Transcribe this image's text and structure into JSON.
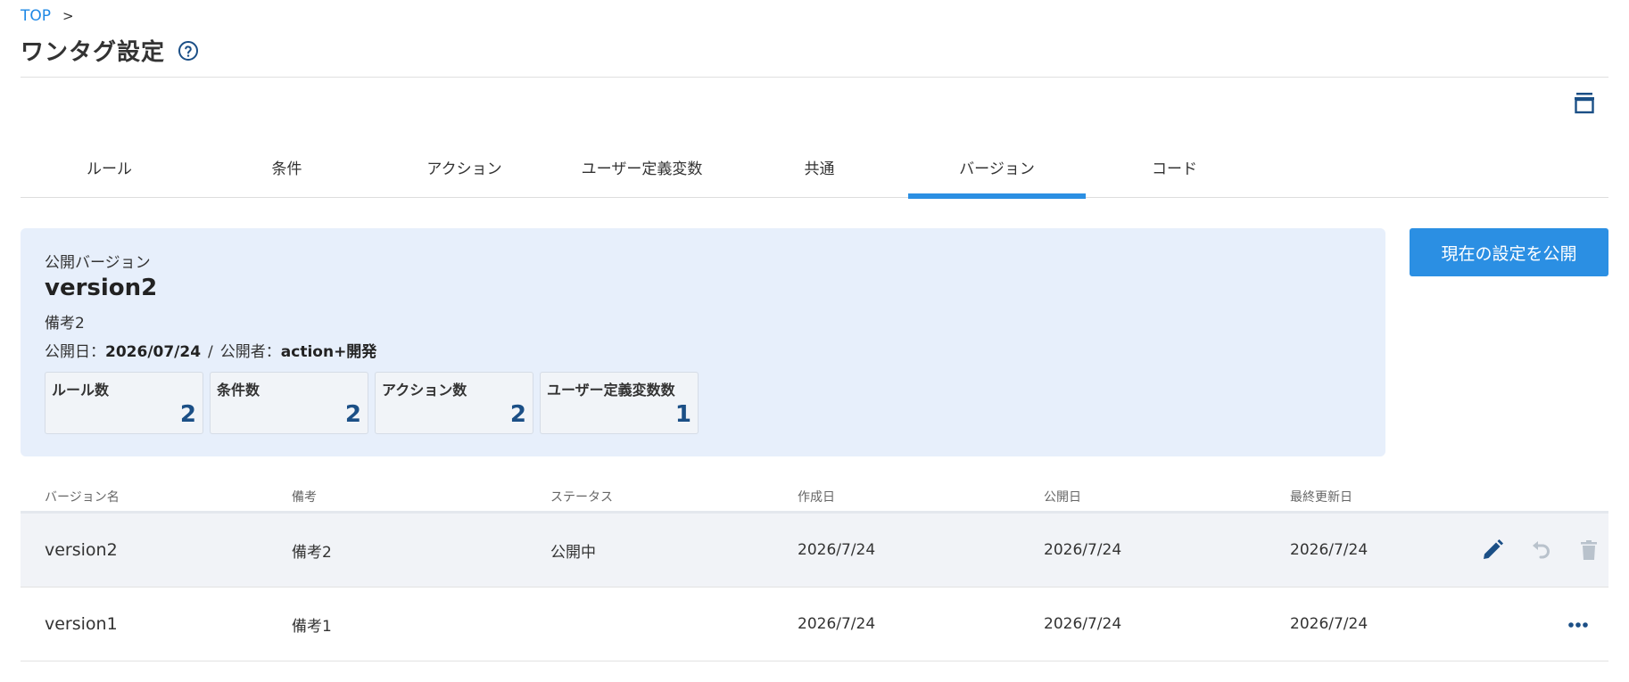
{
  "breadcrumb": {
    "top": "TOP",
    "separator": ">"
  },
  "page": {
    "title": "ワンタグ設定"
  },
  "tabs": [
    {
      "label": "ルール",
      "active": false
    },
    {
      "label": "条件",
      "active": false
    },
    {
      "label": "アクション",
      "active": false
    },
    {
      "label": "ユーザー定義変数",
      "active": false
    },
    {
      "label": "共通",
      "active": false
    },
    {
      "label": "バージョン",
      "active": true
    },
    {
      "label": "コード",
      "active": false
    }
  ],
  "summary": {
    "label": "公開バージョン",
    "version": "version2",
    "note": "備考2",
    "publish_date_label": "公開日：",
    "publish_date": "2026/07/24",
    "slash": "/",
    "publisher_label": "公開者：",
    "publisher": "action+開発",
    "stats": [
      {
        "label": "ルール数",
        "value": "2"
      },
      {
        "label": "条件数",
        "value": "2"
      },
      {
        "label": "アクション数",
        "value": "2"
      },
      {
        "label": "ユーザー定義変数数",
        "value": "1"
      }
    ]
  },
  "publish_button": "現在の設定を公開",
  "table": {
    "headers": [
      "バージョン名",
      "備考",
      "ステータス",
      "作成日",
      "公開日",
      "最終更新日"
    ],
    "rows": [
      {
        "name": "version2",
        "note": "備考2",
        "status": "公開中",
        "created": "2026/7/24",
        "published": "2026/7/24",
        "updated": "2026/7/24"
      },
      {
        "name": "version1",
        "note": "備考1",
        "status": "",
        "created": "2026/7/24",
        "published": "2026/7/24",
        "updated": "2026/7/24"
      }
    ]
  },
  "icons": {
    "help": "help-circle-icon",
    "archive": "archive-icon",
    "edit": "pencil-icon",
    "revert": "undo-icon",
    "delete": "trash-icon",
    "more": "more-horizontal-icon"
  },
  "colors": {
    "accent": "#2b8fe3",
    "dark_blue": "#1b4f86",
    "summary_bg": "#e7effb"
  }
}
